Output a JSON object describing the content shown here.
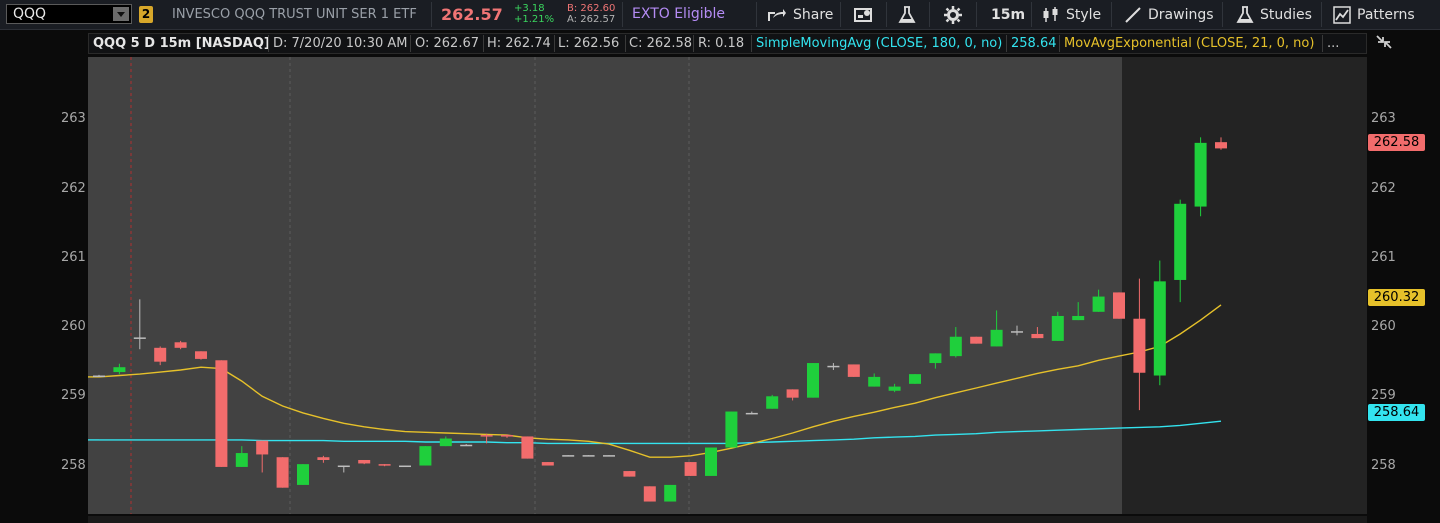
{
  "header": {
    "symbol": "QQQ",
    "link_number": "2",
    "description": "INVESCO QQQ TRUST UNIT SER 1 ETF",
    "last": "262.57",
    "change": "+3.18",
    "change_pct": "+1.21%",
    "bid": "B: 262.60",
    "ask": "A: 262.57",
    "exto": "EXTO Eligible"
  },
  "toolbar": {
    "share": "Share",
    "timeframe": "15m",
    "style": "Style",
    "drawings": "Drawings",
    "studies": "Studies",
    "patterns": "Patterns"
  },
  "infobar": {
    "title": "QQQ 5 D 15m [NASDAQ]",
    "date": "D: 7/20/20 10:30 AM",
    "open": "O: 262.67",
    "high": "H: 262.74",
    "low": "L: 262.56",
    "close": "C: 262.58",
    "range": "R: 0.18",
    "sma_label": "SimpleMovingAvg (CLOSE, 180, 0, no)",
    "sma_value": "258.64",
    "ema_label": "MovAvgExponential (CLOSE, 21, 0, no)",
    "more": "..."
  },
  "colors": {
    "up": "#1fcf3c",
    "down": "#f26c6c",
    "sma": "#33e4ef",
    "ema": "#e6c12a",
    "exto": "#b58cf5"
  },
  "chart_data": {
    "type": "candlestick",
    "y_ticks_left": [
      "263",
      "262",
      "261",
      "260",
      "259",
      "258"
    ],
    "y_ticks_right": [
      "263",
      "262",
      "261",
      "260",
      "259",
      "258"
    ],
    "price_tags": {
      "last": "262.58",
      "ema": "260.32",
      "sma": "258.64"
    },
    "ylim": [
      257.3,
      263.9
    ],
    "candles": [
      {
        "o": 259.3,
        "h": 259.31,
        "l": 259.29,
        "c": 259.3
      },
      {
        "o": 259.35,
        "h": 259.47,
        "l": 259.32,
        "c": 259.42
      },
      {
        "o": 259.85,
        "h": 260.4,
        "l": 259.68,
        "c": 259.84
      },
      {
        "o": 259.7,
        "h": 259.72,
        "l": 259.45,
        "c": 259.5
      },
      {
        "o": 259.78,
        "h": 259.8,
        "l": 259.68,
        "c": 259.7
      },
      {
        "o": 259.65,
        "h": 259.65,
        "l": 259.53,
        "c": 259.54
      },
      {
        "o": 259.52,
        "h": 259.52,
        "l": 257.98,
        "c": 257.98
      },
      {
        "o": 257.98,
        "h": 258.28,
        "l": 257.98,
        "c": 258.18
      },
      {
        "o": 258.36,
        "h": 258.36,
        "l": 257.9,
        "c": 258.16
      },
      {
        "o": 258.12,
        "h": 258.12,
        "l": 257.68,
        "c": 257.68
      },
      {
        "o": 257.72,
        "h": 258.02,
        "l": 257.72,
        "c": 258.02
      },
      {
        "o": 258.12,
        "h": 258.14,
        "l": 258.04,
        "c": 258.08
      },
      {
        "o": 258.0,
        "h": 258.0,
        "l": 257.9,
        "c": 257.99
      },
      {
        "o": 258.08,
        "h": 258.08,
        "l": 258.02,
        "c": 258.03
      },
      {
        "o": 258.02,
        "h": 258.02,
        "l": 257.99,
        "c": 258.0
      },
      {
        "o": 258.0,
        "h": 258.0,
        "l": 257.99,
        "c": 258.0
      },
      {
        "o": 258.0,
        "h": 258.28,
        "l": 258.0,
        "c": 258.28
      },
      {
        "o": 258.28,
        "h": 258.42,
        "l": 258.28,
        "c": 258.39
      },
      {
        "o": 258.3,
        "h": 258.31,
        "l": 258.29,
        "c": 258.3
      },
      {
        "o": 258.44,
        "h": 258.46,
        "l": 258.32,
        "c": 258.42
      },
      {
        "o": 258.44,
        "h": 258.45,
        "l": 258.4,
        "c": 258.42
      },
      {
        "o": 258.42,
        "h": 258.42,
        "l": 258.1,
        "c": 258.1
      },
      {
        "o": 258.05,
        "h": 258.05,
        "l": 258.0,
        "c": 258.0
      },
      {
        "o": 258.15,
        "h": 258.15,
        "l": 258.14,
        "c": 258.15
      },
      {
        "o": 258.15,
        "h": 258.15,
        "l": 258.14,
        "c": 258.15
      },
      {
        "o": 258.15,
        "h": 258.15,
        "l": 258.14,
        "c": 258.15
      },
      {
        "o": 257.92,
        "h": 257.92,
        "l": 257.84,
        "c": 257.84
      },
      {
        "o": 257.7,
        "h": 257.7,
        "l": 257.48,
        "c": 257.48
      },
      {
        "o": 257.48,
        "h": 257.72,
        "l": 257.48,
        "c": 257.72
      },
      {
        "o": 258.05,
        "h": 258.05,
        "l": 257.85,
        "c": 257.85
      },
      {
        "o": 257.85,
        "h": 258.26,
        "l": 257.85,
        "c": 258.26
      },
      {
        "o": 258.26,
        "h": 258.78,
        "l": 258.26,
        "c": 258.78
      },
      {
        "o": 258.76,
        "h": 258.78,
        "l": 258.74,
        "c": 258.76
      },
      {
        "o": 258.82,
        "h": 259.02,
        "l": 258.82,
        "c": 259.0
      },
      {
        "o": 259.1,
        "h": 259.1,
        "l": 258.94,
        "c": 258.98
      },
      {
        "o": 258.98,
        "h": 259.48,
        "l": 258.98,
        "c": 259.48
      },
      {
        "o": 259.44,
        "h": 259.48,
        "l": 259.38,
        "c": 259.44
      },
      {
        "o": 259.46,
        "h": 259.46,
        "l": 259.28,
        "c": 259.28
      },
      {
        "o": 259.14,
        "h": 259.33,
        "l": 259.14,
        "c": 259.28
      },
      {
        "o": 259.08,
        "h": 259.18,
        "l": 259.06,
        "c": 259.14
      },
      {
        "o": 259.18,
        "h": 259.32,
        "l": 259.18,
        "c": 259.32
      },
      {
        "o": 259.48,
        "h": 259.62,
        "l": 259.4,
        "c": 259.62
      },
      {
        "o": 259.58,
        "h": 260.0,
        "l": 259.56,
        "c": 259.86
      },
      {
        "o": 259.86,
        "h": 259.86,
        "l": 259.76,
        "c": 259.76
      },
      {
        "o": 259.72,
        "h": 260.24,
        "l": 259.72,
        "c": 259.96
      },
      {
        "o": 259.94,
        "h": 260.02,
        "l": 259.88,
        "c": 259.94
      },
      {
        "o": 259.9,
        "h": 260.0,
        "l": 259.84,
        "c": 259.84
      },
      {
        "o": 259.8,
        "h": 260.22,
        "l": 259.8,
        "c": 260.16
      },
      {
        "o": 260.1,
        "h": 260.36,
        "l": 260.1,
        "c": 260.16
      },
      {
        "o": 260.22,
        "h": 260.54,
        "l": 260.22,
        "c": 260.44
      },
      {
        "o": 260.5,
        "h": 260.5,
        "l": 260.12,
        "c": 260.12
      },
      {
        "o": 260.12,
        "h": 260.7,
        "l": 258.8,
        "c": 259.34
      },
      {
        "o": 259.3,
        "h": 260.96,
        "l": 259.16,
        "c": 260.66
      },
      {
        "o": 260.68,
        "h": 261.84,
        "l": 260.36,
        "c": 261.78
      },
      {
        "o": 261.74,
        "h": 262.74,
        "l": 261.6,
        "c": 262.66
      },
      {
        "o": 262.67,
        "h": 262.74,
        "l": 262.56,
        "c": 262.58
      }
    ],
    "sma": [
      258.37,
      258.37,
      258.37,
      258.37,
      258.37,
      258.37,
      258.37,
      258.37,
      258.36,
      258.36,
      258.36,
      258.36,
      258.35,
      258.35,
      258.35,
      258.35,
      258.34,
      258.34,
      258.34,
      258.34,
      258.33,
      258.33,
      258.32,
      258.32,
      258.32,
      258.32,
      258.32,
      258.32,
      258.32,
      258.32,
      258.32,
      258.32,
      258.33,
      258.34,
      258.35,
      258.36,
      258.37,
      258.38,
      258.4,
      258.41,
      258.42,
      258.44,
      258.45,
      258.46,
      258.48,
      258.49,
      258.5,
      258.51,
      258.52,
      258.53,
      258.54,
      258.55,
      258.56,
      258.58,
      258.61,
      258.64
    ],
    "ema": [
      259.28,
      259.3,
      259.32,
      259.35,
      259.38,
      259.42,
      259.4,
      259.22,
      259.0,
      258.86,
      258.76,
      258.68,
      258.61,
      258.56,
      258.52,
      258.49,
      258.48,
      258.47,
      258.46,
      258.45,
      258.44,
      258.4,
      258.38,
      258.37,
      258.35,
      258.31,
      258.22,
      258.12,
      258.12,
      258.14,
      258.19,
      258.25,
      258.32,
      258.39,
      258.47,
      258.56,
      258.64,
      258.71,
      258.77,
      258.84,
      258.9,
      258.98,
      259.05,
      259.12,
      259.19,
      259.26,
      259.33,
      259.39,
      259.44,
      259.52,
      259.58,
      259.64,
      259.72,
      259.9,
      260.1,
      260.32
    ]
  }
}
